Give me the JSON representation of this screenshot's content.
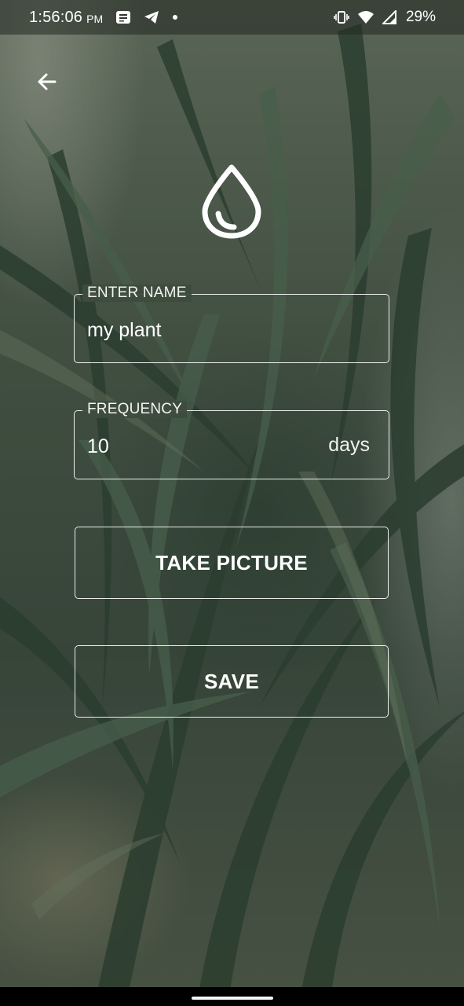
{
  "status_bar": {
    "time": "1:56:06",
    "ampm": "PM",
    "battery": "29%",
    "icons": [
      "news-icon",
      "telegram-icon",
      "dot-icon",
      "vibrate-icon",
      "wifi-icon",
      "signal-icon"
    ]
  },
  "header": {
    "back_icon": "arrow-back-icon"
  },
  "logo_icon": "water-drop-icon",
  "form": {
    "name": {
      "label": "ENTER NAME",
      "value": "my plant"
    },
    "frequency": {
      "label": "FREQUENCY",
      "value": "10",
      "suffix": "days"
    }
  },
  "buttons": {
    "take_picture": "TAKE PICTURE",
    "save": "SAVE"
  },
  "colors": {
    "foreground": "#ffffff",
    "overlay": "#3e4d40"
  }
}
